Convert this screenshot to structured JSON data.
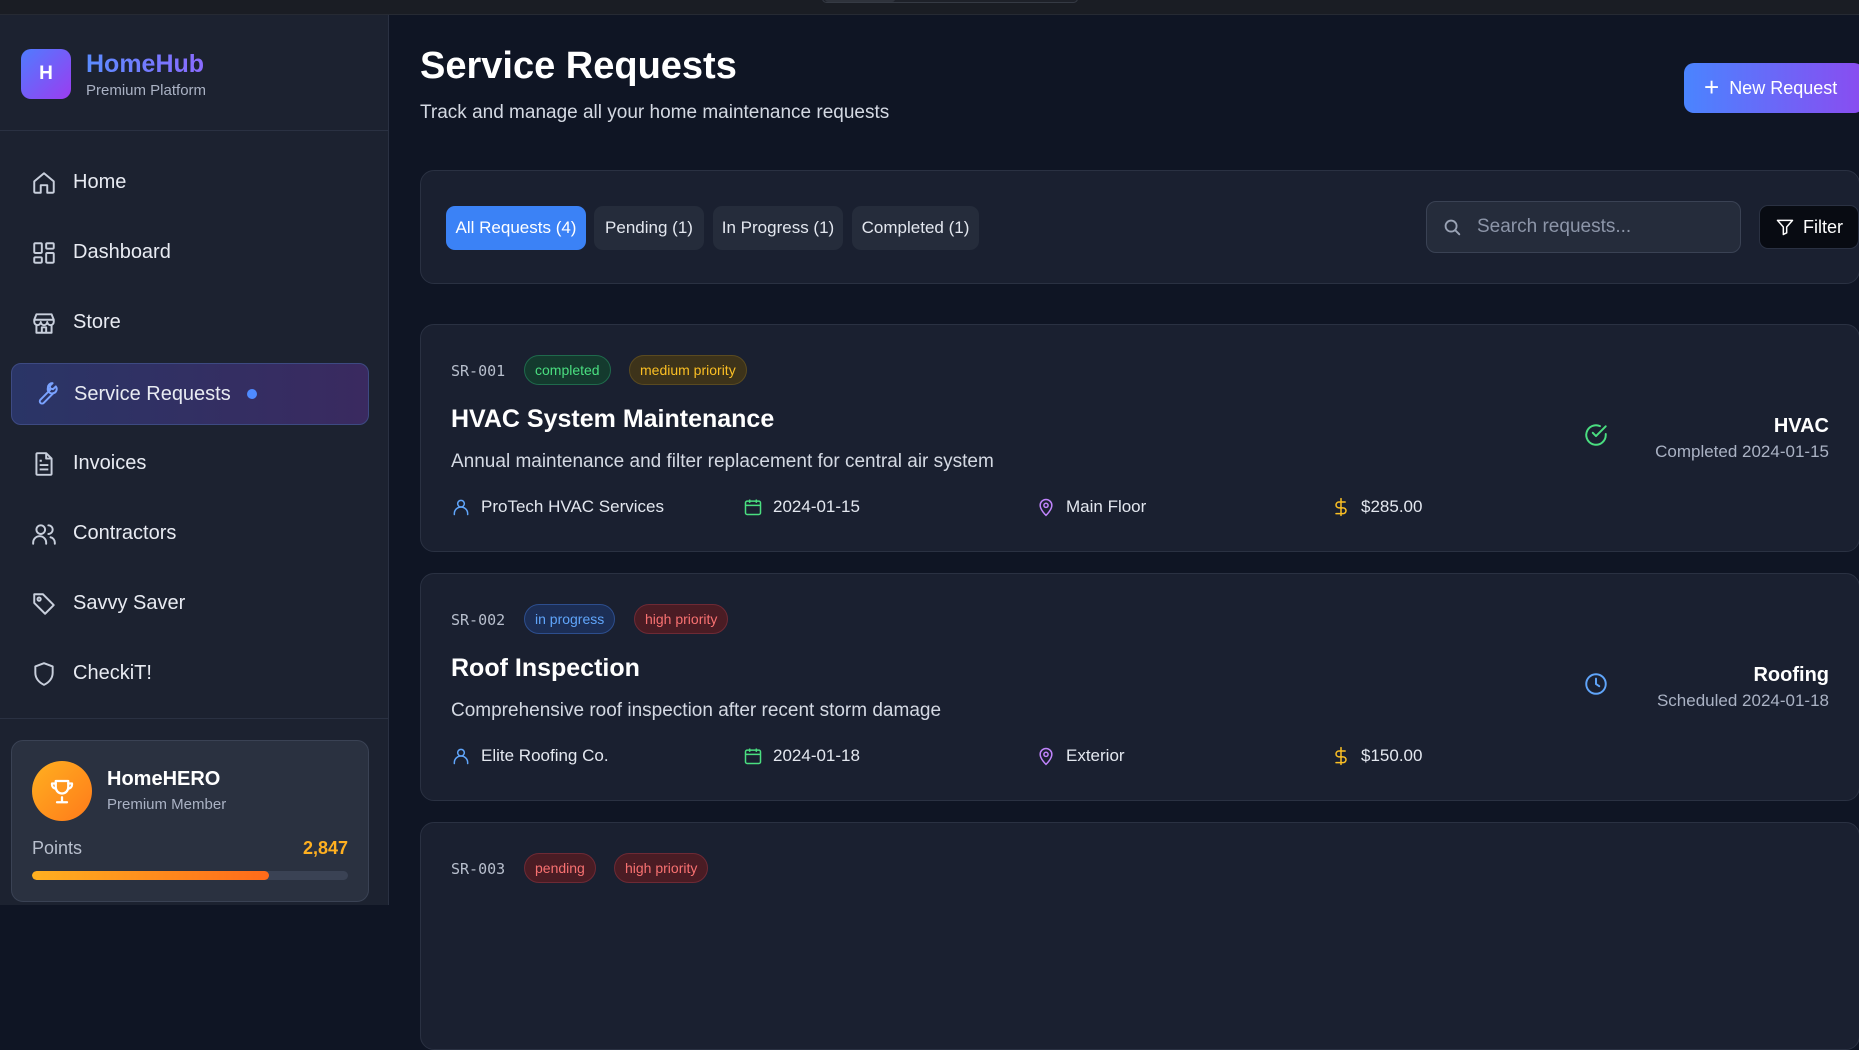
{
  "brand": {
    "logo_letter": "H",
    "name": "HomeHub",
    "subtitle": "Premium Platform"
  },
  "nav": [
    {
      "label": "Home",
      "icon": "home-icon"
    },
    {
      "label": "Dashboard",
      "icon": "dashboard-icon"
    },
    {
      "label": "Store",
      "icon": "store-icon"
    },
    {
      "label": "Service Requests",
      "icon": "wrench-icon",
      "active": true
    },
    {
      "label": "Invoices",
      "icon": "file-icon"
    },
    {
      "label": "Contractors",
      "icon": "users-icon"
    },
    {
      "label": "Savvy Saver",
      "icon": "tag-icon"
    },
    {
      "label": "CheckiT!",
      "icon": "shield-icon"
    }
  ],
  "hero": {
    "name": "HomeHERO",
    "subtitle": "Premium Member",
    "points_label": "Points",
    "points_value": "2,847",
    "progress_fraction": 0.75
  },
  "header": {
    "title": "Service Requests",
    "subtitle": "Track and manage all your home maintenance requests",
    "new_button": "New Request"
  },
  "filters": {
    "tabs": [
      "All Requests (4)",
      "Pending (1)",
      "In Progress (1)",
      "Completed (1)"
    ],
    "active_tab": 0,
    "search_placeholder": "Search requests...",
    "filter_button": "Filter"
  },
  "requests": [
    {
      "id": "SR-001",
      "status": "completed",
      "priority": "medium priority",
      "title": "HVAC System Maintenance",
      "description": "Annual maintenance and filter replacement for central air system",
      "contractor": "ProTech HVAC Services",
      "date": "2024-01-15",
      "location": "Main Floor",
      "cost": "$285.00",
      "category": "HVAC",
      "status_detail": "Completed 2024-01-15"
    },
    {
      "id": "SR-002",
      "status": "in progress",
      "priority": "high priority",
      "title": "Roof Inspection",
      "description": "Comprehensive roof inspection after recent storm damage",
      "contractor": "Elite Roofing Co.",
      "date": "2024-01-18",
      "location": "Exterior",
      "cost": "$150.00",
      "category": "Roofing",
      "status_detail": "Scheduled 2024-01-18"
    },
    {
      "id": "SR-003",
      "status": "pending",
      "priority": "high priority"
    }
  ],
  "colors": {
    "accent": "#3b82f6",
    "completed": "#4ade80",
    "in_progress": "#60a5fa",
    "pending": "#f87171",
    "medium": "#fbbf24",
    "points": "#ffb020"
  }
}
